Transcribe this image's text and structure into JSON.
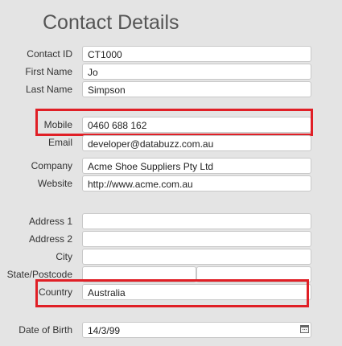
{
  "page_title": "Contact Details",
  "fields": {
    "contact_id": {
      "label": "Contact ID",
      "value": "CT1000"
    },
    "first_name": {
      "label": "First Name",
      "value": "Jo"
    },
    "last_name": {
      "label": "Last Name",
      "value": "Simpson"
    },
    "mobile": {
      "label": "Mobile",
      "value": "0460 688 162"
    },
    "email": {
      "label": "Email",
      "value": "developer@databuzz.com.au"
    },
    "company": {
      "label": "Company",
      "value": "Acme Shoe Suppliers Pty Ltd"
    },
    "website": {
      "label": "Website",
      "value": "http://www.acme.com.au"
    },
    "address1": {
      "label": "Address 1",
      "value": ""
    },
    "address2": {
      "label": "Address 2",
      "value": ""
    },
    "city": {
      "label": "City",
      "value": ""
    },
    "state_postcode": {
      "label": "State/Postcode",
      "state_value": "",
      "postcode_value": ""
    },
    "country": {
      "label": "Country",
      "value": "Australia"
    },
    "dob": {
      "label": "Date of Birth",
      "value": "14/3/99"
    }
  },
  "icons": {
    "date_picker": "calendar-icon"
  },
  "colors": {
    "highlight": "#e01f26",
    "background": "#e4e4e4"
  }
}
